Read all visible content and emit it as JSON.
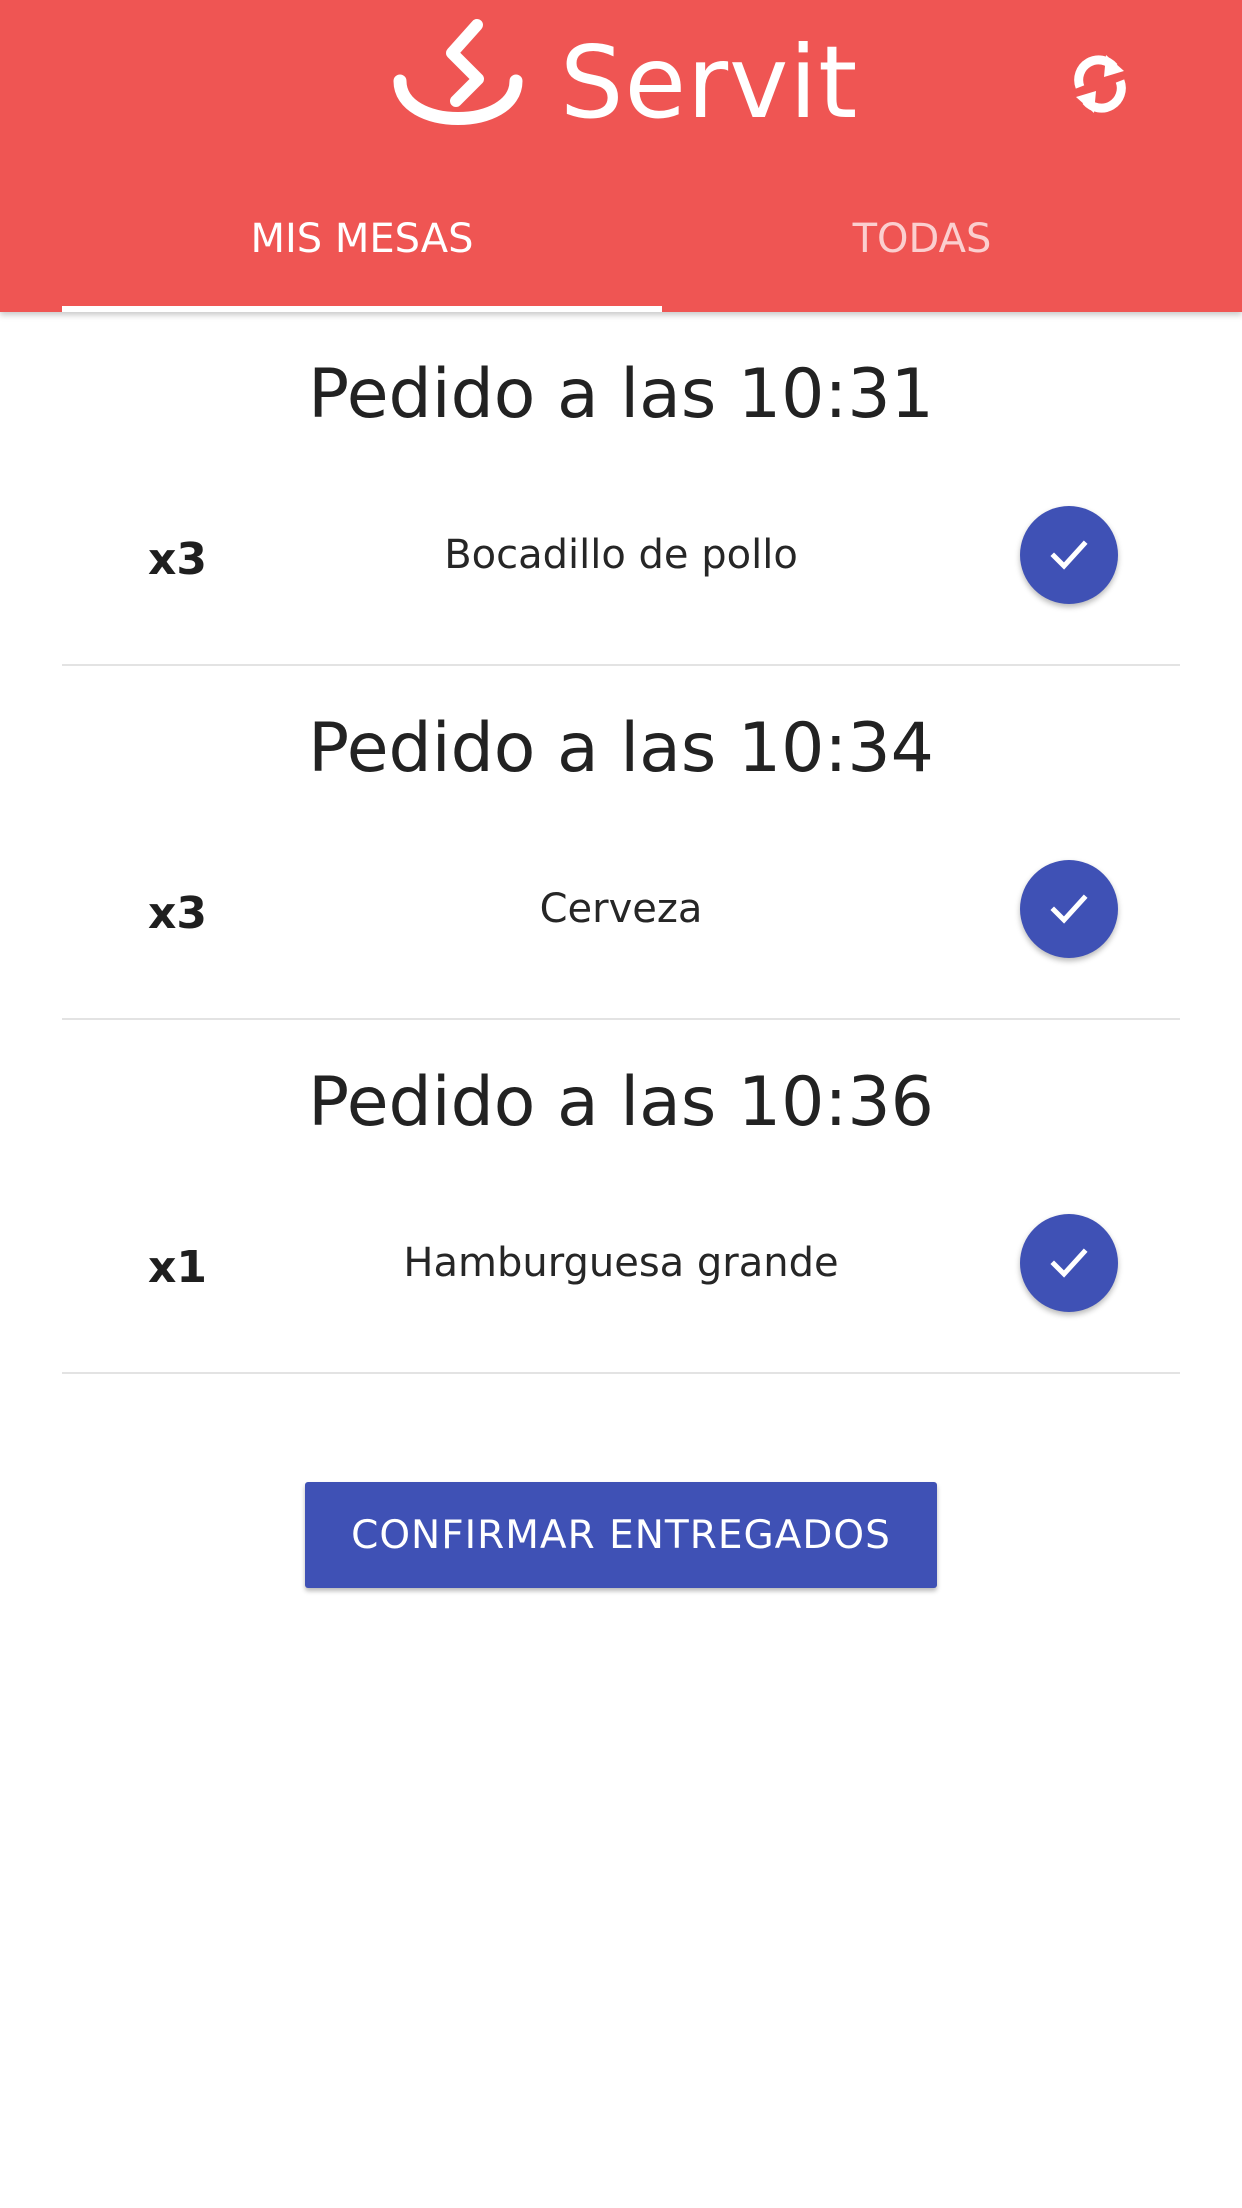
{
  "header": {
    "brand_name": "Servit",
    "logo_icon": "servit-logo-icon",
    "refresh_icon": "refresh-icon",
    "background_color": "#ef5553"
  },
  "tabs": [
    {
      "label": "MIS MESAS",
      "active": true
    },
    {
      "label": "TODAS",
      "active": false
    }
  ],
  "orders": [
    {
      "title": "Pedido a las 10:31",
      "quantity": "x3",
      "item": "Bocadillo de pollo"
    },
    {
      "title": "Pedido a las 10:34",
      "quantity": "x3",
      "item": "Cerveza"
    },
    {
      "title": "Pedido a las 10:36",
      "quantity": "x1",
      "item": "Hamburguesa grande"
    }
  ],
  "confirm_button": {
    "label": "CONFIRMAR ENTREGADOS"
  },
  "accent_color": "#3f51b5"
}
